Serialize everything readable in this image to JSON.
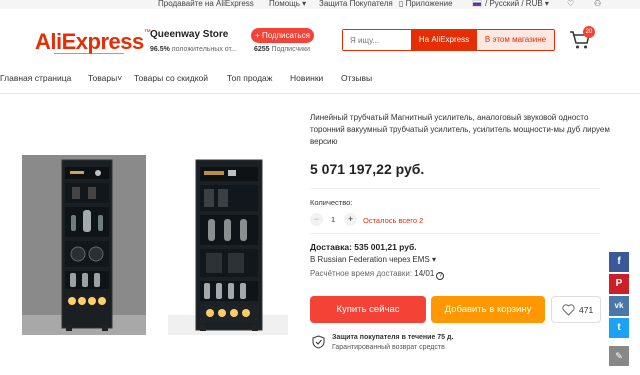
{
  "topbar": {
    "sell": "Продавайте на AliExpress",
    "help": "Помощь",
    "protection": "Защита Покупателя",
    "app": "Приложение",
    "locale": "/ Русский / RUB"
  },
  "header": {
    "logo": "AliExpress",
    "store_name": "Queenway Store",
    "rating_value": "96.5%",
    "rating_text": "положительных от...",
    "subscribe_label": "+ Подписаться",
    "subscribers_count": "6255",
    "subscribers_text": "Подписчики",
    "search_placeholder": "Я ищу...",
    "search_ae_label": "На AliExpress",
    "search_store_label": "В этом магазине",
    "cart_count": "20"
  },
  "nav": {
    "items": [
      "Главная страница",
      "Товары",
      "Товары со скидкой",
      "Топ продаж",
      "Новинки",
      "Отзывы"
    ]
  },
  "product": {
    "title": "Линейный трубчатый Магнитный усилитель, аналоговый звуковой одностo торонний вакуумный трубчатый усилитель, усилитель мощности-мы дуб лируем версию",
    "price": "5 071 197,22 руб.",
    "qty_label": "Количество:",
    "qty_minus": "−",
    "qty_value": "1",
    "qty_plus": "+",
    "qty_left": "Осталось всего 2",
    "shipping_label": "Доставка: 535 001,21 руб.",
    "shipping_via": "В Russian Federation через EMS",
    "delivery_label": "Расчётное время доставки:",
    "delivery_date": "14/01",
    "buy_label": "Купить сейчас",
    "cart_label": "Добавить в корзину",
    "wish_count": "471",
    "protection_title": "Защита покупателя в течение 75 д.",
    "protection_sub": "Гарантированный возврат средств"
  },
  "social": {
    "fb": "f",
    "pin": "P",
    "vk": "vk",
    "tw": "t",
    "edit": "✎"
  },
  "colors": {
    "brand": "#e62e04",
    "buy": "#f44336",
    "cart": "#ff9800"
  }
}
